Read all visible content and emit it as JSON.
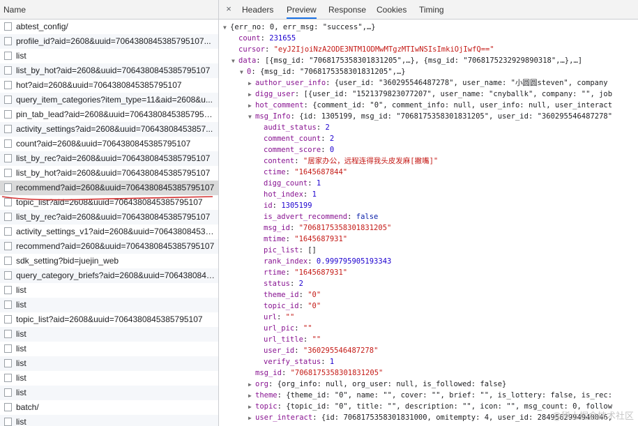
{
  "left_panel": {
    "header": "Name",
    "requests": [
      "abtest_config/",
      "profile_id?aid=2608&uuid=7064380845385795107...",
      "list",
      "list_by_hot?aid=2608&uuid=7064380845385795107",
      "hot?aid=2608&uuid=7064380845385795107",
      "query_item_categories?item_type=11&aid=2608&u...",
      "pin_tab_lead?aid=2608&uuid=70643808453857951...",
      "activity_settings?aid=2608&uuid=70643808453857...",
      "count?aid=2608&uuid=7064380845385795107",
      "list_by_rec?aid=2608&uuid=7064380845385795107",
      "list_by_hot?aid=2608&uuid=7064380845385795107",
      "recommend?aid=2608&uuid=7064380845385795107",
      "topic_list?aid=2608&uuid=7064380845385795107",
      "list_by_rec?aid=2608&uuid=7064380845385795107",
      "activity_settings_v1?aid=2608&uuid=706438084538...",
      "recommend?aid=2608&uuid=7064380845385795107",
      "sdk_setting?bid=juejin_web",
      "query_category_briefs?aid=2608&uuid=7064380845...",
      "list",
      "list",
      "topic_list?aid=2608&uuid=7064380845385795107",
      "list",
      "list",
      "list",
      "list",
      "list",
      "batch/",
      "list"
    ],
    "selected_index": 11
  },
  "right_panel": {
    "close_icon": "×",
    "tabs": [
      "Headers",
      "Preview",
      "Response",
      "Cookies",
      "Timing"
    ],
    "active_tab": "Preview"
  },
  "preview": {
    "lines": [
      {
        "indent": 0,
        "tri": "down",
        "parts": [
          [
            "p",
            "{err_no: 0, err_msg: \"success\",…}"
          ]
        ]
      },
      {
        "indent": 1,
        "tri": "",
        "parts": [
          [
            "k",
            "count"
          ],
          [
            "p",
            ": "
          ],
          [
            "n",
            "231655"
          ]
        ]
      },
      {
        "indent": 1,
        "tri": "",
        "parts": [
          [
            "k",
            "cursor"
          ],
          [
            "p",
            ": "
          ],
          [
            "s",
            "\"eyJ2IjoiNzA2ODE3NTM1ODMwMTgzMTIwNSIsImkiOjIwfQ==\""
          ]
        ]
      },
      {
        "indent": 1,
        "tri": "down",
        "parts": [
          [
            "k",
            "data"
          ],
          [
            "p",
            ": [{msg_id: \"7068175358301831205\",…}, {msg_id: \"7068175232929890318\",…},…]"
          ]
        ]
      },
      {
        "indent": 2,
        "tri": "down",
        "parts": [
          [
            "k",
            "0"
          ],
          [
            "p",
            ": {msg_id: \"7068175358301831205\",…}"
          ]
        ]
      },
      {
        "indent": 3,
        "tri": "right",
        "parts": [
          [
            "k",
            "author_user_info"
          ],
          [
            "p",
            ": {user_id: \"360295546487278\", user_name: \"小圆圆steven\", company"
          ]
        ]
      },
      {
        "indent": 3,
        "tri": "right",
        "parts": [
          [
            "k",
            "digg_user"
          ],
          [
            "p",
            ": [{user_id: \"1521379823077207\", user_name: \"cnyballk\", company: \"\", job"
          ]
        ]
      },
      {
        "indent": 3,
        "tri": "right",
        "parts": [
          [
            "k",
            "hot_comment"
          ],
          [
            "p",
            ": {comment_id: \"0\", comment_info: null, user_info: null, user_interact"
          ]
        ]
      },
      {
        "indent": 3,
        "tri": "down",
        "parts": [
          [
            "k",
            "msg_Info"
          ],
          [
            "p",
            ": {id: 1305199, msg_id: \"7068175358301831205\", user_id: \"360295546487278\""
          ]
        ]
      },
      {
        "indent": 4,
        "tri": "",
        "parts": [
          [
            "k",
            "audit_status"
          ],
          [
            "p",
            ": "
          ],
          [
            "n",
            "2"
          ]
        ]
      },
      {
        "indent": 4,
        "tri": "",
        "parts": [
          [
            "k",
            "comment_count"
          ],
          [
            "p",
            ": "
          ],
          [
            "n",
            "2"
          ]
        ]
      },
      {
        "indent": 4,
        "tri": "",
        "parts": [
          [
            "k",
            "comment_score"
          ],
          [
            "p",
            ": "
          ],
          [
            "n",
            "0"
          ]
        ]
      },
      {
        "indent": 4,
        "tri": "",
        "parts": [
          [
            "k",
            "content"
          ],
          [
            "p",
            ": "
          ],
          [
            "s",
            "\"居家办公，远程连得我头皮发麻[撇嘴]\""
          ]
        ]
      },
      {
        "indent": 4,
        "tri": "",
        "parts": [
          [
            "k",
            "ctime"
          ],
          [
            "p",
            ": "
          ],
          [
            "s",
            "\"1645687844\""
          ]
        ]
      },
      {
        "indent": 4,
        "tri": "",
        "parts": [
          [
            "k",
            "digg_count"
          ],
          [
            "p",
            ": "
          ],
          [
            "n",
            "1"
          ]
        ]
      },
      {
        "indent": 4,
        "tri": "",
        "parts": [
          [
            "k",
            "hot_index"
          ],
          [
            "p",
            ": "
          ],
          [
            "n",
            "1"
          ]
        ]
      },
      {
        "indent": 4,
        "tri": "",
        "parts": [
          [
            "k",
            "id"
          ],
          [
            "p",
            ": "
          ],
          [
            "n",
            "1305199"
          ]
        ]
      },
      {
        "indent": 4,
        "tri": "",
        "parts": [
          [
            "k",
            "is_advert_recommend"
          ],
          [
            "p",
            ": "
          ],
          [
            "kw",
            "false"
          ]
        ]
      },
      {
        "indent": 4,
        "tri": "",
        "parts": [
          [
            "k",
            "msg_id"
          ],
          [
            "p",
            ": "
          ],
          [
            "s",
            "\"7068175358301831205\""
          ]
        ]
      },
      {
        "indent": 4,
        "tri": "",
        "parts": [
          [
            "k",
            "mtime"
          ],
          [
            "p",
            ": "
          ],
          [
            "s",
            "\"1645687931\""
          ]
        ]
      },
      {
        "indent": 4,
        "tri": "",
        "parts": [
          [
            "k",
            "pic_list"
          ],
          [
            "p",
            ": []"
          ]
        ]
      },
      {
        "indent": 4,
        "tri": "",
        "parts": [
          [
            "k",
            "rank_index"
          ],
          [
            "p",
            ": "
          ],
          [
            "n",
            "0.999795905193343"
          ]
        ]
      },
      {
        "indent": 4,
        "tri": "",
        "parts": [
          [
            "k",
            "rtime"
          ],
          [
            "p",
            ": "
          ],
          [
            "s",
            "\"1645687931\""
          ]
        ]
      },
      {
        "indent": 4,
        "tri": "",
        "parts": [
          [
            "k",
            "status"
          ],
          [
            "p",
            ": "
          ],
          [
            "n",
            "2"
          ]
        ]
      },
      {
        "indent": 4,
        "tri": "",
        "parts": [
          [
            "k",
            "theme_id"
          ],
          [
            "p",
            ": "
          ],
          [
            "s",
            "\"0\""
          ]
        ]
      },
      {
        "indent": 4,
        "tri": "",
        "parts": [
          [
            "k",
            "topic_id"
          ],
          [
            "p",
            ": "
          ],
          [
            "s",
            "\"0\""
          ]
        ]
      },
      {
        "indent": 4,
        "tri": "",
        "parts": [
          [
            "k",
            "url"
          ],
          [
            "p",
            ": "
          ],
          [
            "s",
            "\"\""
          ]
        ]
      },
      {
        "indent": 4,
        "tri": "",
        "parts": [
          [
            "k",
            "url_pic"
          ],
          [
            "p",
            ": "
          ],
          [
            "s",
            "\"\""
          ]
        ]
      },
      {
        "indent": 4,
        "tri": "",
        "parts": [
          [
            "k",
            "url_title"
          ],
          [
            "p",
            ": "
          ],
          [
            "s",
            "\"\""
          ]
        ]
      },
      {
        "indent": 4,
        "tri": "",
        "parts": [
          [
            "k",
            "user_id"
          ],
          [
            "p",
            ": "
          ],
          [
            "s",
            "\"360295546487278\""
          ]
        ]
      },
      {
        "indent": 4,
        "tri": "",
        "parts": [
          [
            "k",
            "verify_status"
          ],
          [
            "p",
            ": "
          ],
          [
            "n",
            "1"
          ]
        ]
      },
      {
        "indent": 3,
        "tri": "",
        "parts": [
          [
            "k",
            "msg_id"
          ],
          [
            "p",
            ": "
          ],
          [
            "s",
            "\"7068175358301831205\""
          ]
        ]
      },
      {
        "indent": 3,
        "tri": "right",
        "parts": [
          [
            "k",
            "org"
          ],
          [
            "p",
            ": {org_info: null, org_user: null, is_followed: false}"
          ]
        ]
      },
      {
        "indent": 3,
        "tri": "right",
        "parts": [
          [
            "k",
            "theme"
          ],
          [
            "p",
            ": {theme_id: \"0\", name: \"\", cover: \"\", brief: \"\", is_lottery: false, is_rec:"
          ]
        ]
      },
      {
        "indent": 3,
        "tri": "right",
        "parts": [
          [
            "k",
            "topic"
          ],
          [
            "p",
            ": {topic_id: \"0\", title: \"\", description: \"\", icon: \"\", msg_count: 0, follow"
          ]
        ]
      },
      {
        "indent": 3,
        "tri": "right",
        "parts": [
          [
            "k",
            "user_interact"
          ],
          [
            "p",
            ": {id: 7068175358301831000, omitempty: 4, user_id: 2849562994940046,"
          ]
        ]
      }
    ]
  },
  "watermark": "@稀土掘金技术社区",
  "colors": {
    "underline": "#d32f2f",
    "active_tab": "#1a73e8"
  }
}
